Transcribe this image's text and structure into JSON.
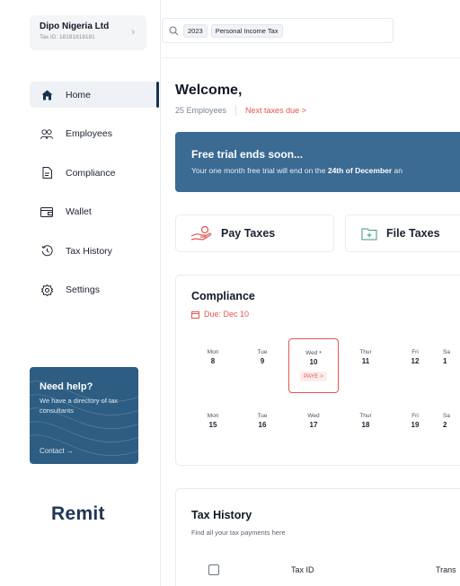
{
  "org": {
    "name": "Dipo Nigeria Ltd",
    "tax_id": "Tax ID: 18181818181",
    "chevron": "›"
  },
  "sidebar": {
    "items": [
      {
        "label": "Home",
        "icon": "home-icon",
        "active": true
      },
      {
        "label": "Employees",
        "icon": "users-icon",
        "active": false
      },
      {
        "label": "Compliance",
        "icon": "document-icon",
        "active": false
      },
      {
        "label": "Wallet",
        "icon": "wallet-icon",
        "active": false
      },
      {
        "label": "Tax History",
        "icon": "history-icon",
        "active": false
      },
      {
        "label": "Settings",
        "icon": "gear-icon",
        "active": false
      }
    ]
  },
  "help": {
    "title": "Need help?",
    "text": "We have a directory of tax consultants",
    "contact": "Contact →"
  },
  "logo": {
    "text": "Remit"
  },
  "search": {
    "chips": [
      "2023",
      "Personal Income Tax"
    ]
  },
  "welcome": {
    "title": "Welcome,",
    "employees": "25 Employees",
    "next_taxes": "Next taxes due >"
  },
  "trial": {
    "title": "Free trial ends soon...",
    "text_before": "Your one month free trial will end on the ",
    "text_bold": "24th of December",
    "text_after": " an"
  },
  "actions": {
    "pay": "Pay Taxes",
    "file": "File Taxes"
  },
  "compliance": {
    "title": "Compliance",
    "due": "Due: Dec 10",
    "week1": [
      {
        "day": "Mon",
        "num": "8"
      },
      {
        "day": "Tue",
        "num": "9"
      },
      {
        "day": "Wed",
        "num": "10",
        "dot": "•",
        "tag": "PAYE >"
      },
      {
        "day": "Thur",
        "num": "11"
      },
      {
        "day": "Fri",
        "num": "12"
      },
      {
        "day": "Sa",
        "num": "1"
      }
    ],
    "week2": [
      {
        "day": "Mon",
        "num": "15"
      },
      {
        "day": "Tue",
        "num": "16"
      },
      {
        "day": "Wed",
        "num": "17"
      },
      {
        "day": "Thur",
        "num": "18"
      },
      {
        "day": "Fri",
        "num": "19"
      },
      {
        "day": "Sa",
        "num": "2"
      }
    ]
  },
  "history": {
    "title": "Tax History",
    "subtitle": "Find all your tax payments here",
    "col_taxid": "Tax ID",
    "col_trans": "Trans"
  },
  "colors": {
    "navy": "#16324f",
    "banner": "#3b6a92",
    "accent_red": "#e4564f"
  }
}
